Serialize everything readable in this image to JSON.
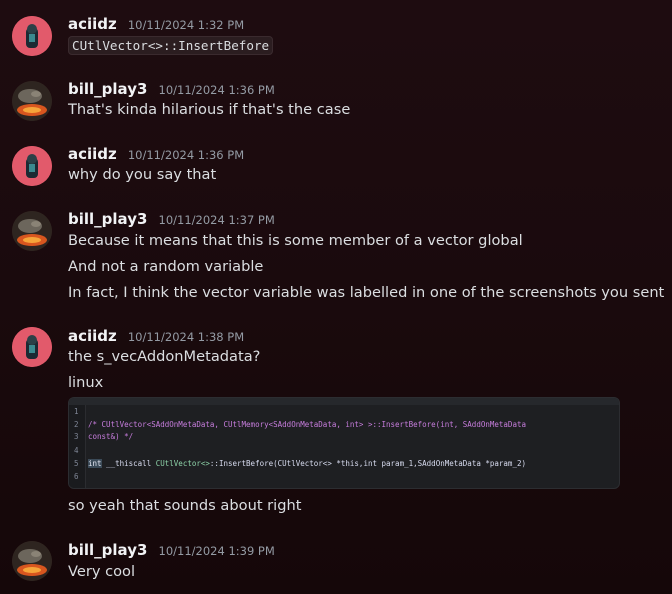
{
  "messages": [
    {
      "author": "aciidz",
      "timestamp": "10/11/2024 1:32 PM",
      "lines": [
        "CUtlVector<>::InsertBefore"
      ]
    },
    {
      "author": "bill_play3",
      "timestamp": "10/11/2024 1:36 PM",
      "lines": [
        "That's kinda hilarious if that's the case"
      ]
    },
    {
      "author": "aciidz",
      "timestamp": "10/11/2024 1:36 PM",
      "lines": [
        "why do you say that"
      ]
    },
    {
      "author": "bill_play3",
      "timestamp": "10/11/2024 1:37 PM",
      "lines": [
        "Because it means that this is some member of a vector global",
        "And not a random variable",
        "In fact, I think the vector variable was labelled in one of the screenshots you sent"
      ]
    },
    {
      "author": "aciidz",
      "timestamp": "10/11/2024 1:38 PM",
      "lines": [
        "the s_vecAddonMetadata?",
        "linux",
        "so yeah that sounds about right"
      ]
    },
    {
      "author": "bill_play3",
      "timestamp": "10/11/2024 1:39 PM",
      "lines": [
        "Very cool"
      ]
    }
  ],
  "code_image": {
    "line_numbers": [
      "1",
      "2",
      "3",
      "4",
      "5",
      "6"
    ],
    "line2_a": "/* CUtlVector<SAddOnMetaData, CUtlMemory<SAddOnMetaData, int> >::InsertBefore(int, SAddOnMetaData",
    "line3": "   const&) */",
    "line5_kw": "int",
    "line5_b": " __thiscall ",
    "line5_type": "CUtlVector<>",
    "line5_c": "::InsertBefore(CUtlVector<> *this,int param_1,SAddOnMetaData *param_2)"
  },
  "colors": {
    "background": "#1a0d10",
    "aciidz_avatar": "#e25a6b",
    "bill_avatar": "#3a2a22"
  },
  "icons": {
    "aciidz_avatar": "avatar-aciidz-icon",
    "bill_avatar": "avatar-bill-icon"
  }
}
